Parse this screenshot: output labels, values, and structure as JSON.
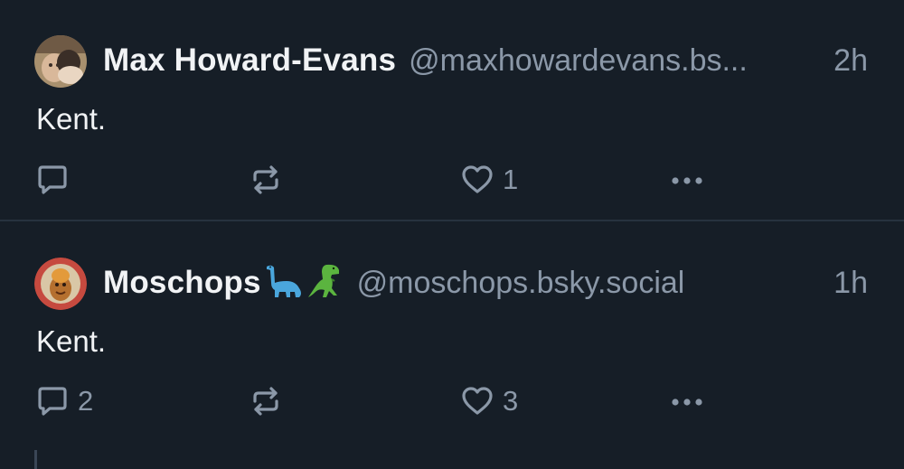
{
  "posts": [
    {
      "display_name": "Max Howard-Evans",
      "handle": "@maxhowardevans.bs...",
      "time": "2h",
      "text": "Kent.",
      "reply_count": "",
      "repost_count": "",
      "like_count": "1",
      "avatar": "user-photo-avatar"
    },
    {
      "display_name": "Moschops",
      "name_emoji": [
        "sauropod-emoji",
        "t-rex-emoji"
      ],
      "handle": "@moschops.bsky.social",
      "time": "1h",
      "text": "Kent.",
      "reply_count": "2",
      "repost_count": "",
      "like_count": "3",
      "avatar": "illustrated-avatar"
    }
  ],
  "icons": {
    "reply": "reply-icon",
    "repost": "repost-icon",
    "like": "heart-icon",
    "more": "more-options-icon"
  },
  "colors": {
    "background": "#161e27",
    "text_primary": "#f1f3f5",
    "text_secondary": "#8b98a8",
    "divider": "#27323f"
  }
}
